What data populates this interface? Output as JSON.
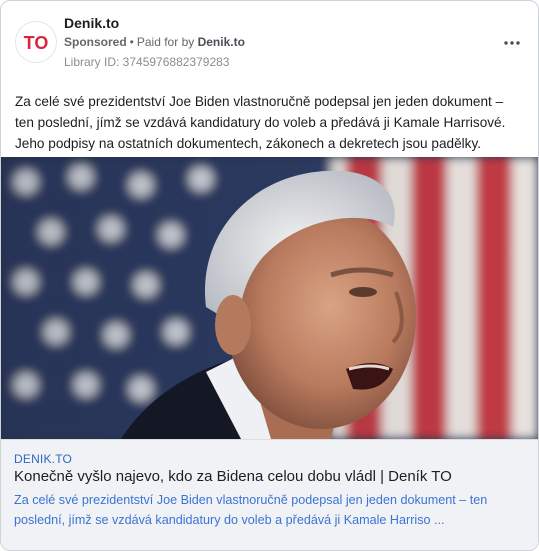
{
  "ad": {
    "page_name": "Denik.to",
    "sponsored_label": "Sponsored",
    "paid_for_prefix": "Paid for by",
    "advertiser": "Denik.to",
    "library_id": "Library ID: 3745976882379283",
    "avatar_text": "TO",
    "body_text": "Za celé své prezidentství Joe Biden vlastnoručně podepsal jen jeden dokument – ten poslední, jímž se vzdává kandidatury do voleb a předává ji Kamale Harrisové. Jeho podpisy na ostatních dokumentech, zákonech a dekretech jsou padělky."
  },
  "link": {
    "domain": "DENIK.TO",
    "title": "Konečně vyšlo najevo, kdo za Bidena celou dobu vládl | Deník TO",
    "description": "Za celé své prezidentství Joe Biden vlastnoručně podepsal jen jeden dokument – ten poslední, jímž se vzdává kandidatury do voleb a předává ji Kamale Harriso ..."
  },
  "colors": {
    "brand_red": "#d7263d",
    "link_blue": "#3b74d6"
  },
  "icons": {
    "more": "more-horizontal-icon"
  }
}
